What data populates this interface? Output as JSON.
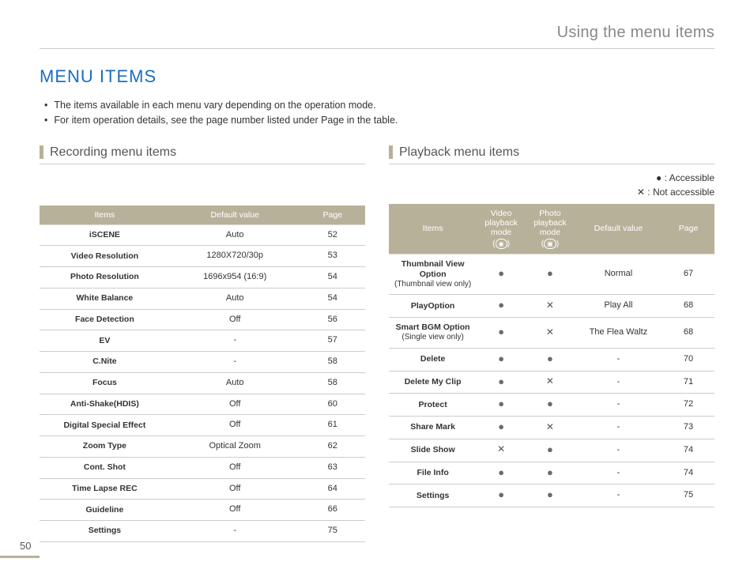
{
  "header": "Using the menu items",
  "title": "MENU ITEMS",
  "bullets": [
    "The items available in each menu vary depending on the operation mode.",
    "For item operation details, see the page number listed under Page in the table."
  ],
  "recording": {
    "heading": "Recording menu items",
    "cols": [
      "Items",
      "Default value",
      "Page"
    ],
    "rows": [
      {
        "item": "iSCENE",
        "value": "Auto",
        "page": "52"
      },
      {
        "item": "Video Resolution",
        "value": "1280X720/30p",
        "page": "53"
      },
      {
        "item": "Photo Resolution",
        "value": "1696x954 (16:9)",
        "page": "54"
      },
      {
        "item": "White Balance",
        "value": "Auto",
        "page": "54"
      },
      {
        "item": "Face Detection",
        "value": "Off",
        "page": "56"
      },
      {
        "item": "EV",
        "value": "-",
        "page": "57"
      },
      {
        "item": "C.Nite",
        "value": "-",
        "page": "58"
      },
      {
        "item": "Focus",
        "value": "Auto",
        "page": "58"
      },
      {
        "item": "Anti-Shake(HDIS)",
        "value": "Off",
        "page": "60"
      },
      {
        "item": "Digital Special Effect",
        "value": "Off",
        "page": "61"
      },
      {
        "item": "Zoom Type",
        "value": "Optical Zoom",
        "page": "62"
      },
      {
        "item": "Cont. Shot",
        "value": "Off",
        "page": "63"
      },
      {
        "item": "Time Lapse REC",
        "value": "Off",
        "page": "64"
      },
      {
        "item": "Guideline",
        "value": "Off",
        "page": "66"
      },
      {
        "item": "Settings",
        "value": "-",
        "page": "75"
      }
    ]
  },
  "playback": {
    "heading": "Playback menu items",
    "legend": {
      "accessible": "● : Accessible",
      "not": "✕ : Not accessible"
    },
    "cols": {
      "items": "Items",
      "video": "Video playback mode",
      "photo": "Photo playback mode",
      "default": "Default value",
      "page": "Page"
    },
    "rows": [
      {
        "item": "Thumbnail View Option",
        "note": "(Thumbnail view only)",
        "v": "●",
        "p": "●",
        "d": "Normal",
        "page": "67"
      },
      {
        "item": "PlayOption",
        "note": "",
        "v": "●",
        "p": "✕",
        "d": "Play All",
        "page": "68"
      },
      {
        "item": "Smart BGM Option",
        "note": "(Single view only)",
        "v": "●",
        "p": "✕",
        "d": "The Flea Waltz",
        "page": "68"
      },
      {
        "item": "Delete",
        "note": "",
        "v": "●",
        "p": "●",
        "d": "-",
        "page": "70"
      },
      {
        "item": "Delete My Clip",
        "note": "",
        "v": "●",
        "p": "✕",
        "d": "-",
        "page": "71"
      },
      {
        "item": "Protect",
        "note": "",
        "v": "●",
        "p": "●",
        "d": "-",
        "page": "72"
      },
      {
        "item": "Share Mark",
        "note": "",
        "v": "●",
        "p": "✕",
        "d": "-",
        "page": "73"
      },
      {
        "item": "Slide Show",
        "note": "",
        "v": "✕",
        "p": "●",
        "d": "-",
        "page": "74"
      },
      {
        "item": "File Info",
        "note": "",
        "v": "●",
        "p": "●",
        "d": "-",
        "page": "74"
      },
      {
        "item": "Settings",
        "note": "",
        "v": "●",
        "p": "●",
        "d": "-",
        "page": "75"
      }
    ]
  },
  "pageNumber": "50"
}
